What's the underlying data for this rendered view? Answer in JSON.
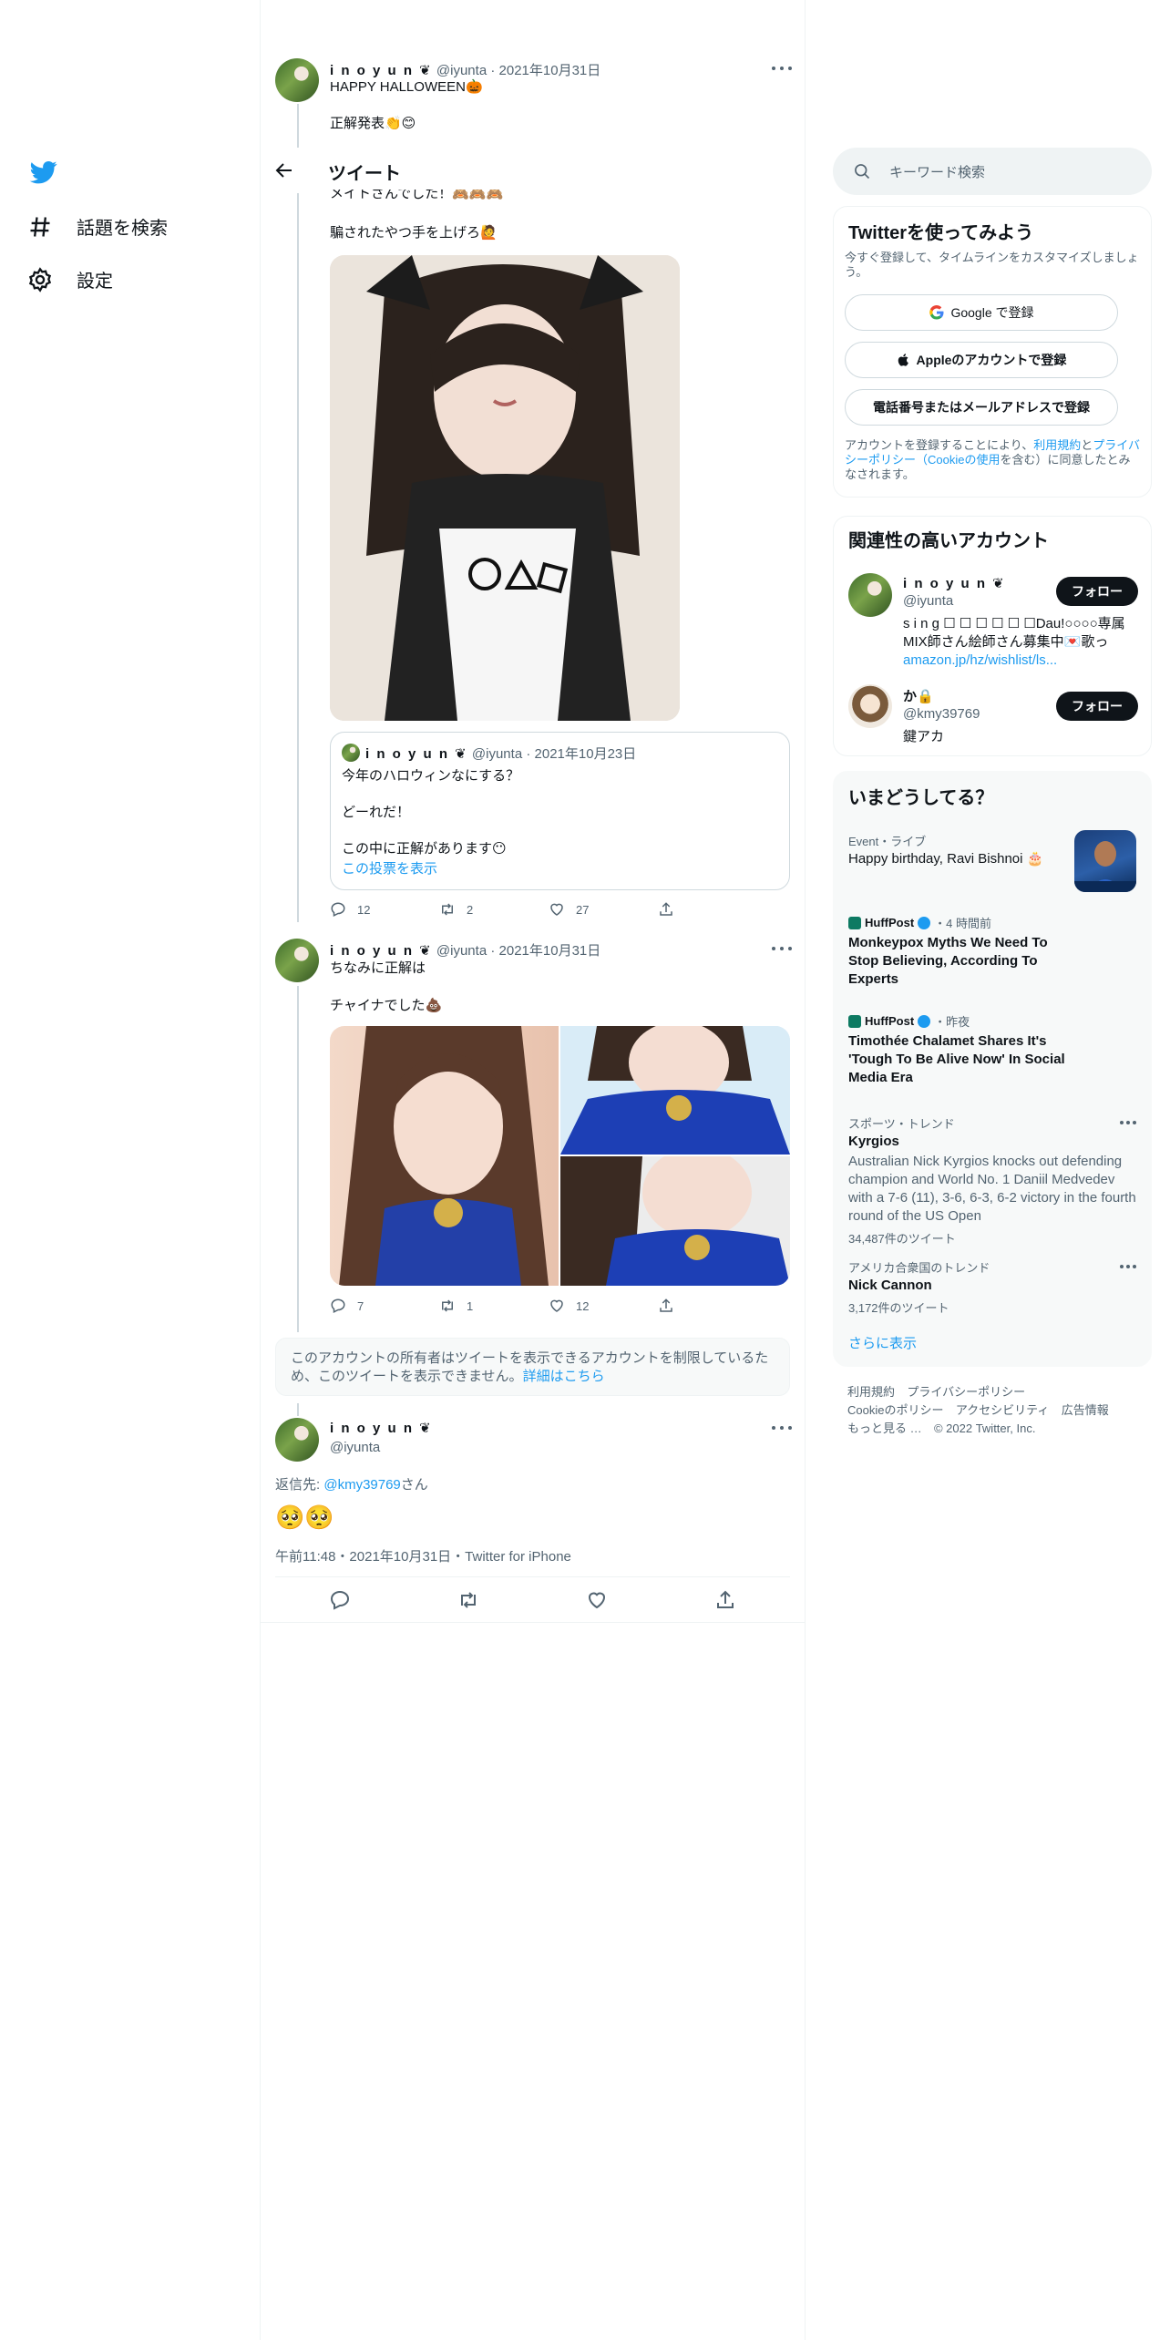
{
  "nav": {
    "logo": "twitter-bird-icon",
    "explore_label": "話題を検索",
    "settings_label": "設定"
  },
  "header": {
    "back_icon": "arrow-left-icon",
    "title": "ツイート"
  },
  "tweet1": {
    "name": "i n o y u n ❦",
    "handle": "@iyunta",
    "date": "2021年10月31日",
    "line1": "HAPPY HALLOWEEN🎃",
    "line2": "正解発表👏😊"
  },
  "tweet2": {
    "line_partial": "メイトさんでした！🙈🙈🙈",
    "line2": "騙されたやつ手を上げろ🙋",
    "quote": {
      "name": "i n o y u n ❦",
      "handle": "@iyunta",
      "date": "2021年10月23日",
      "line1": "今年のハロウィンなにする？",
      "line2": "どーれだ！",
      "line3": "この中に正解があります😶",
      "poll_link": "この投票を表示"
    },
    "stats": {
      "replies": "12",
      "retweets": "2",
      "likes": "27"
    }
  },
  "tweet3": {
    "name": "i n o y u n ❦",
    "handle": "@iyunta",
    "date": "2021年10月31日",
    "line1": "ちなみに正解は",
    "line2": "チャイナでした💩",
    "stats": {
      "replies": "7",
      "retweets": "1",
      "likes": "12"
    }
  },
  "restricted": {
    "text": "このアカウントの所有者はツイートを表示できるアカウントを制限しているため、このツイートを表示できません。",
    "link": "詳細はこちら"
  },
  "main_tweet": {
    "name": "i n o y u n ❦",
    "handle": "@iyunta",
    "reply_prefix": "返信先: ",
    "reply_to": "@kmy39769",
    "reply_suffix": "さん",
    "body": "🥺🥺",
    "meta": "午前11:48・2021年10月31日・Twitter for iPhone"
  },
  "search": {
    "placeholder": "キーワード検索"
  },
  "signup": {
    "title": "Twitterを使ってみよう",
    "subtitle": "今すぐ登録して、タイムラインをカスタマイズしましょう。",
    "google": "Google で登録",
    "apple": "Appleのアカウントで登録",
    "phone": "電話番号またはメールアドレスで登録",
    "terms_1": "アカウントを登録することにより、",
    "terms_link1": "利用規約",
    "terms_2": "と",
    "terms_link2": "プライバシーポリシー（Cookieの使用",
    "terms_3": "を含む）に同意したとみなされます。"
  },
  "related": {
    "title": "関連性の高いアカウント",
    "accounts": [
      {
        "name": "i n o y u n ❦",
        "handle": "@iyunta",
        "follow": "フォロー",
        "bio": "s i n g ☐ ☐ ☐ ☐ ☐ ☐Dau!○○○○専属MIX師さん絵師さん募集中💌歌っ",
        "bio_link": "amazon.jp/hz/wishlist/ls..."
      },
      {
        "name": "か🔒",
        "handle": "@kmy39769",
        "follow": "フォロー",
        "bio": "鍵アカ"
      }
    ]
  },
  "trends": {
    "title": "いまどうしてる？",
    "items": [
      {
        "context": "Event・ライブ",
        "title": "Happy birthday, Ravi Bishnoi 🎂"
      },
      {
        "source": "HuffPost",
        "time": "・4 時間前",
        "title": "Monkeypox Myths We Need To Stop Believing, According To Experts"
      },
      {
        "source": "HuffPost",
        "time": "・昨夜",
        "title": "Timothée Chalamet Shares It's 'Tough To Be Alive Now' In Social Media Era"
      },
      {
        "context": "スポーツ・トレンド",
        "title": "Kyrgios",
        "desc": "Australian Nick Kyrgios knocks out defending champion and World No. 1 Daniil Medvedev with a 7-6 (11), 3-6, 6-3, 6-2 victory in the fourth round of the US Open",
        "count": "34,487件のツイート"
      },
      {
        "context": "アメリカ合衆国のトレンド",
        "title": "Nick Cannon",
        "count": "3,172件のツイート"
      }
    ],
    "more": "さらに表示"
  },
  "footer": {
    "links": [
      "利用規約",
      "プライバシーポリシー",
      "Cookieのポリシー",
      "アクセシビリティ",
      "広告情報",
      "もっと見る …"
    ],
    "copyright": "© 2022 Twitter, Inc."
  },
  "colors": {
    "accent": "#1d9bf0",
    "text": "#0f1419",
    "muted": "#536471"
  }
}
